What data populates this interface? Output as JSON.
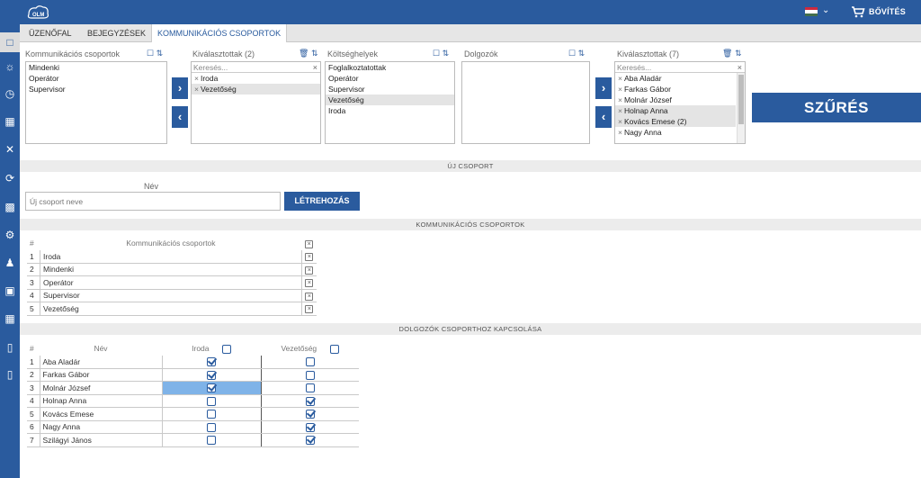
{
  "header": {
    "logo_text": "OLM",
    "expand_label": "BŐVÍTÉS",
    "flag_colors": [
      "#cd2a3e",
      "#ffffff",
      "#436f4d"
    ]
  },
  "sidebar": {
    "icons": [
      "building-icon",
      "sun-icon",
      "clock-icon",
      "calendar-icon",
      "tools-icon",
      "sync-icon",
      "bar-chart-icon",
      "settings-icon",
      "users-icon",
      "factory-icon",
      "grid-chart-icon",
      "inbox-icon",
      "inbox-alt-icon"
    ]
  },
  "tabs": [
    "ÜZENŐFAL",
    "BEJEGYZÉSEK",
    "KOMMUNIKÁCIÓS CSOPORTOK"
  ],
  "filters": {
    "groups": {
      "title": "Kommunikációs csoportok",
      "items": [
        "Mindenki",
        "Operátor",
        "Supervisor"
      ]
    },
    "selected_groups": {
      "title": "Kiválasztottak (2)",
      "search_placeholder": "Keresés...",
      "items": [
        "Iroda",
        "Vezetőség"
      ]
    },
    "cost_centers": {
      "title": "Költséghelyek",
      "items": [
        "Foglalkoztatottak",
        "Operátor",
        "Supervisor",
        "Vezetőség",
        "Iroda"
      ]
    },
    "employees": {
      "title": "Dolgozók",
      "items": []
    },
    "selected_employees": {
      "title": "Kiválasztottak (7)",
      "search_placeholder": "Keresés...",
      "items": [
        "Aba Aladár",
        "Farkas Gábor",
        "Molnár József",
        "Holnap Anna",
        "Kovács Emese (2)",
        "Nagy Anna"
      ]
    },
    "filter_button": "SZŰRÉS"
  },
  "new_group": {
    "section_title": "ÚJ CSOPORT",
    "name_label": "Név",
    "name_placeholder": "Új csoport neve",
    "create_button": "LÉTREHOZÁS"
  },
  "groups_table": {
    "section_title": "KOMMUNIKÁCIÓS CSOPORTOK",
    "columns": [
      "#",
      "Kommunikációs csoportok"
    ],
    "rows": [
      {
        "num": "1",
        "name": "Iroda"
      },
      {
        "num": "2",
        "name": "Mindenki"
      },
      {
        "num": "3",
        "name": "Operátor"
      },
      {
        "num": "4",
        "name": "Supervisor"
      },
      {
        "num": "5",
        "name": "Vezetőség"
      }
    ]
  },
  "employees_table": {
    "section_title": "DOLGOZÓK CSOPORTHOZ KAPCSOLÁSA",
    "columns": [
      "#",
      "Név",
      "Iroda",
      "Vezetőség"
    ],
    "rows": [
      {
        "num": "1",
        "name": "Aba Aladár",
        "iroda": true,
        "vezetoseg": false
      },
      {
        "num": "2",
        "name": "Farkas Gábor",
        "iroda": true,
        "vezetoseg": false
      },
      {
        "num": "3",
        "name": "Molnár József",
        "iroda": true,
        "vezetoseg": false
      },
      {
        "num": "4",
        "name": "Holnap Anna",
        "iroda": false,
        "vezetoseg": true
      },
      {
        "num": "5",
        "name": "Kovács Emese",
        "iroda": false,
        "vezetoseg": true
      },
      {
        "num": "6",
        "name": "Nagy Anna",
        "iroda": false,
        "vezetoseg": true
      },
      {
        "num": "7",
        "name": "Szilágyi János",
        "iroda": false,
        "vezetoseg": true
      }
    ]
  }
}
